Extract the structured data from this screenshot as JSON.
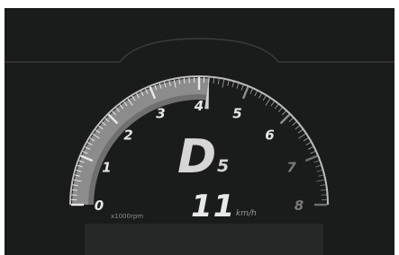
{
  "tachometer": {
    "labels": [
      "0",
      "1",
      "2",
      "3",
      "4",
      "5",
      "6",
      "7",
      "8"
    ],
    "unit_label": "x1000rpm",
    "current_rpm_thousands": 4.2,
    "redline_from": 7
  },
  "gear": {
    "mode": "D",
    "number": "5"
  },
  "speed": {
    "value": "11",
    "unit": "km/h"
  },
  "colors": {
    "background": "#1a1b1b",
    "sweep_fill": "#8c8c8c",
    "needle": "#d0d0d0",
    "label_active": "#e6e6e6",
    "label_inactive": "#7a7a7a"
  }
}
